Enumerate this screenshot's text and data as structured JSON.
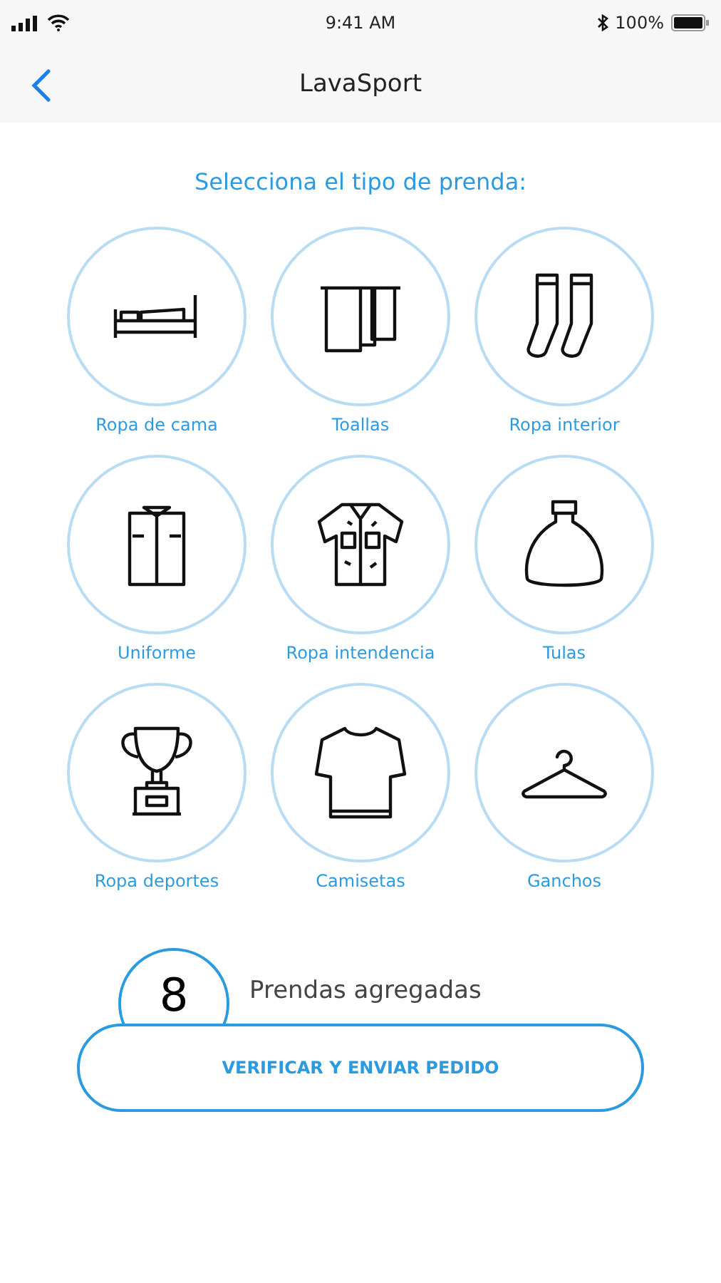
{
  "status_bar": {
    "time": "9:41 AM",
    "battery": "100%"
  },
  "nav": {
    "title": "LavaSport"
  },
  "heading": "Selecciona el tipo de prenda:",
  "items": [
    {
      "label": "Ropa de cama",
      "kind": "bed"
    },
    {
      "label": "Toallas",
      "kind": "towels"
    },
    {
      "label": "Ropa interior",
      "kind": "socks"
    },
    {
      "label": "Uniforme",
      "kind": "shirt"
    },
    {
      "label": "Ropa intendencia",
      "kind": "camo"
    },
    {
      "label": "Tulas",
      "kind": "bag"
    },
    {
      "label": "Ropa deportes",
      "kind": "trophy"
    },
    {
      "label": "Camisetas",
      "kind": "tshirt"
    },
    {
      "label": "Ganchos",
      "kind": "hanger"
    }
  ],
  "counter": {
    "count": "8",
    "label": "Prendas agregadas"
  },
  "button": "VERIFICAR Y ENVIAR PEDIDO"
}
